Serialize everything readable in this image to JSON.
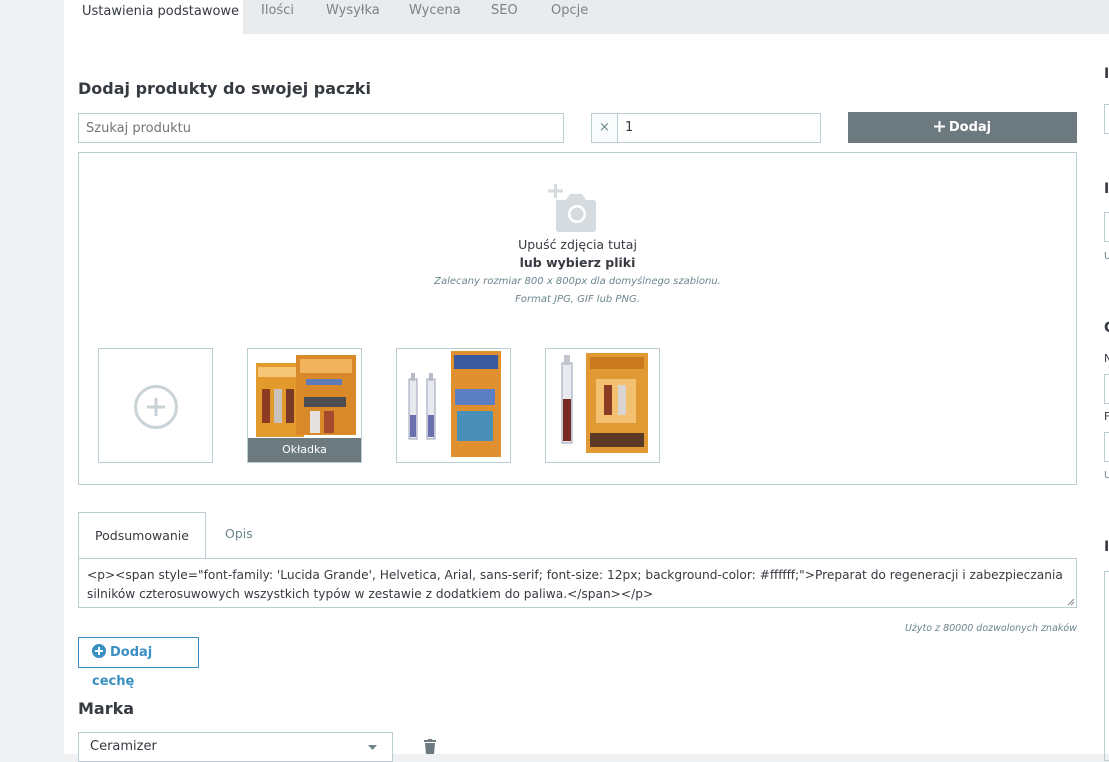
{
  "tabs": [
    {
      "label": "Ustawienia podstawowe",
      "active": true
    },
    {
      "label": "Ilości"
    },
    {
      "label": "Wysyłka"
    },
    {
      "label": "Wycena"
    },
    {
      "label": "SEO"
    },
    {
      "label": "Opcje"
    }
  ],
  "pack": {
    "title": "Dodaj produkty do swojej paczki",
    "search_placeholder": "Szukaj produktu",
    "times_symbol": "×",
    "quantity": "1",
    "add_label": "Dodaj",
    "add_icon": "plus-icon"
  },
  "dropzone": {
    "icon": "camera-add-icon",
    "drop_text": "Upuść zdjęcia tutaj",
    "choose_text": "lub wybierz pliki",
    "hint1": "Zalecany rozmiar 800 x 800px dla domyślnego szablonu.",
    "hint2": "Format JPG, GIF lub PNG.",
    "cover_label": "Okładka"
  },
  "desc_tabs": [
    {
      "label": "Podsumowanie",
      "active": true
    },
    {
      "label": "Opis"
    }
  ],
  "editor": {
    "text": "<p><span style=\"font-family: 'Lucida Grande', Helvetica, Arial, sans-serif; font-size: 12px; background-color: #ffffff;\">Preparat do regeneracji i zabezpieczania silników czterosuwowych wszystkich typów w zestawie z dodatkiem do paliwa.</span></p>",
    "counter": "Użyto z 80000 dozwolonych znaków"
  },
  "feature": {
    "label": "Dodaj cechę",
    "icon": "plus-circle-icon"
  },
  "brand": {
    "title": "Marka",
    "selected": "Ceramizer",
    "delete_icon": "trash-icon"
  },
  "sidebar": {
    "letters": [
      "I",
      "I",
      "U",
      "C",
      "N",
      "F",
      "U",
      "I"
    ]
  },
  "colors": {
    "accent": "#25b9d7",
    "button_dark": "#6c7a7f",
    "border": "#bbcdd2",
    "feature_blue": "#3a8fc2"
  }
}
